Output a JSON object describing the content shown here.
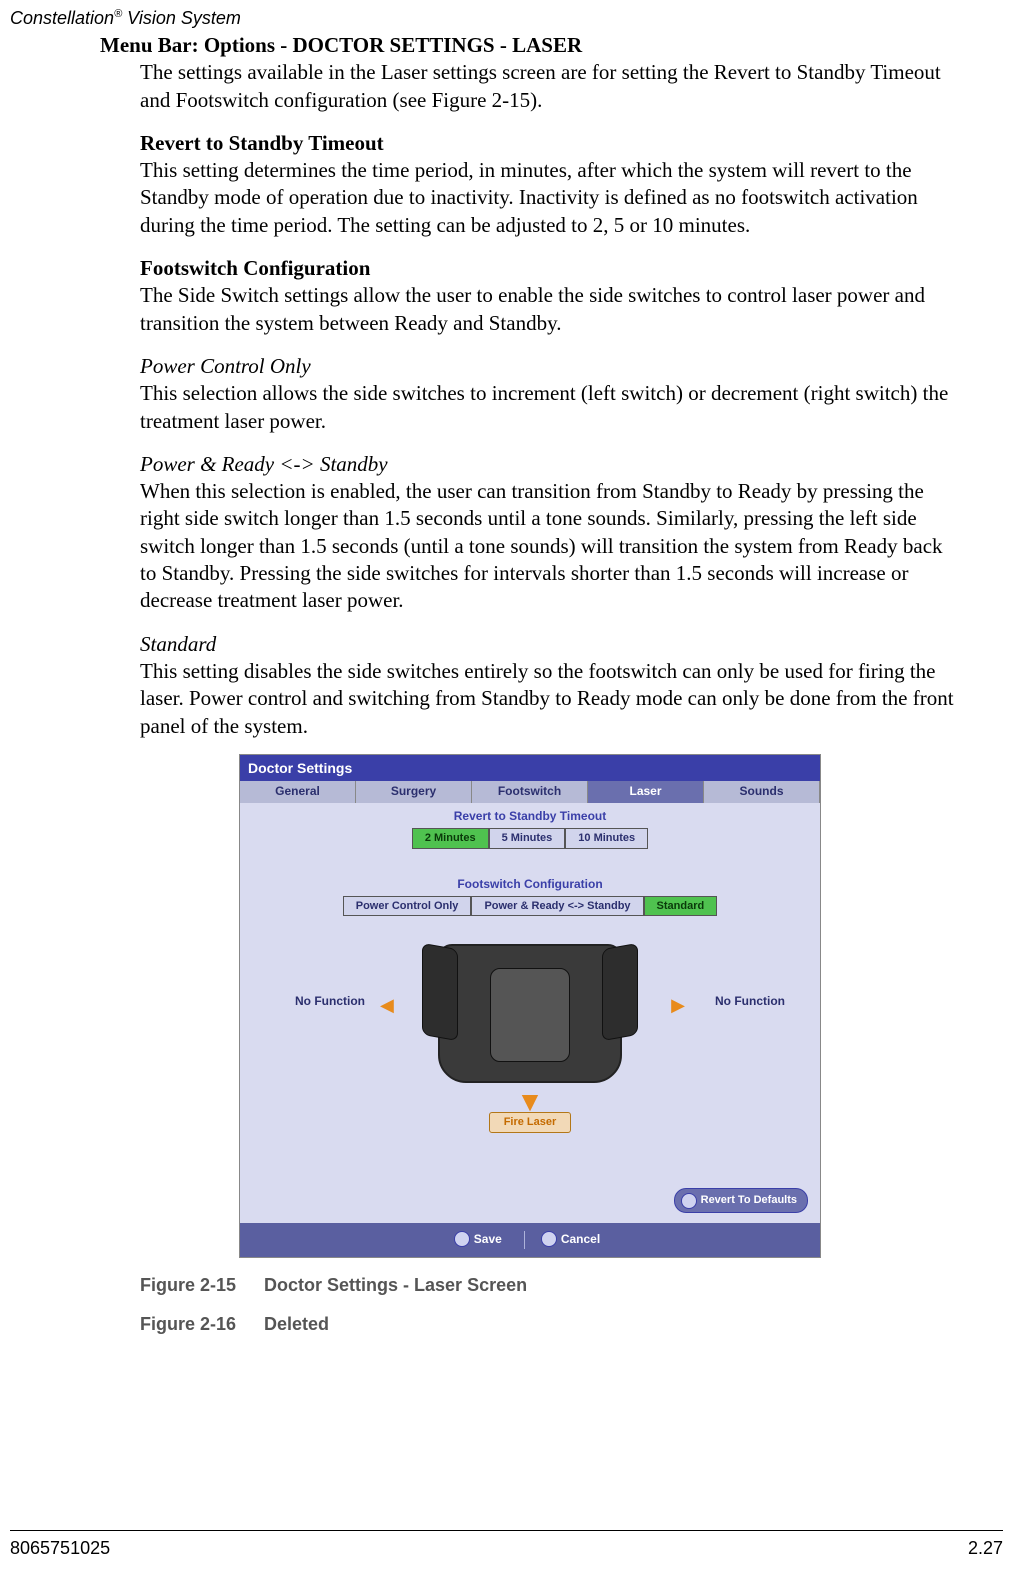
{
  "header": {
    "brand": "Constellation",
    "reg": "®",
    "suffix": " Vision System"
  },
  "menubar": "Menu Bar: Options - DOCTOR SETTINGS - LASER",
  "intro": "The settings available in the Laser settings screen are for setting the Revert to Standby Timeout and Footswitch configuration (see Figure 2-15).",
  "sections": [
    {
      "head": "Revert to Standby Timeout",
      "body": "This setting determines the time period, in minutes, after which the system will revert to the Standby mode of operation due to inactivity. Inactivity is defined as no footswitch activation during the time period. The setting can be adjusted to 2, 5 or 10 minutes."
    },
    {
      "head": "Footswitch Configuration",
      "body": "The Side Switch settings allow the user to enable the side switches to control laser power and transition the system between Ready and Standby."
    }
  ],
  "subs": [
    {
      "head": "Power Control Only",
      "body": "This selection allows the side switches to increment (left switch) or decrement (right switch) the treatment laser power."
    },
    {
      "head": "Power & Ready <-> Standby",
      "body": "When this selection is enabled, the user can transition from Standby to Ready by pressing the right side switch longer than 1.5 seconds until a tone sounds. Similarly, pressing the left side switch longer than 1.5 seconds (until a tone sounds) will transition the system from Ready back to Standby. Pressing the side switches for intervals shorter than 1.5 seconds will increase or decrease treatment laser power."
    },
    {
      "head": "Standard",
      "body": "This setting disables the side switches entirely so the footswitch can only be used for firing the laser. Power control and switching from Standby to Ready mode can only be done from the front panel of the system."
    }
  ],
  "figure": {
    "title": "Doctor Settings",
    "tabs": [
      "General",
      "Surgery",
      "Footswitch",
      "Laser",
      "Sounds"
    ],
    "active_tab_index": 3,
    "revert_title": "Revert to Standby Timeout",
    "revert_options": [
      "2 Minutes",
      "5 Minutes",
      "10 Minutes"
    ],
    "revert_selected_index": 0,
    "foot_title": "Footswitch Configuration",
    "foot_options": [
      "Power Control Only",
      "Power & Ready <-> Standby",
      "Standard"
    ],
    "foot_selected_index": 2,
    "left_label": "No Function",
    "right_label": "No Function",
    "fire_label": "Fire Laser",
    "revert_defaults": "Revert To Defaults",
    "save": "Save",
    "cancel": "Cancel"
  },
  "caption1_num": "Figure 2-15",
  "caption1_text": "Doctor Settings - Laser Screen",
  "caption2_num": "Figure 2-16",
  "caption2_text": "Deleted",
  "footer_left": "8065751025",
  "footer_right": "2.27"
}
